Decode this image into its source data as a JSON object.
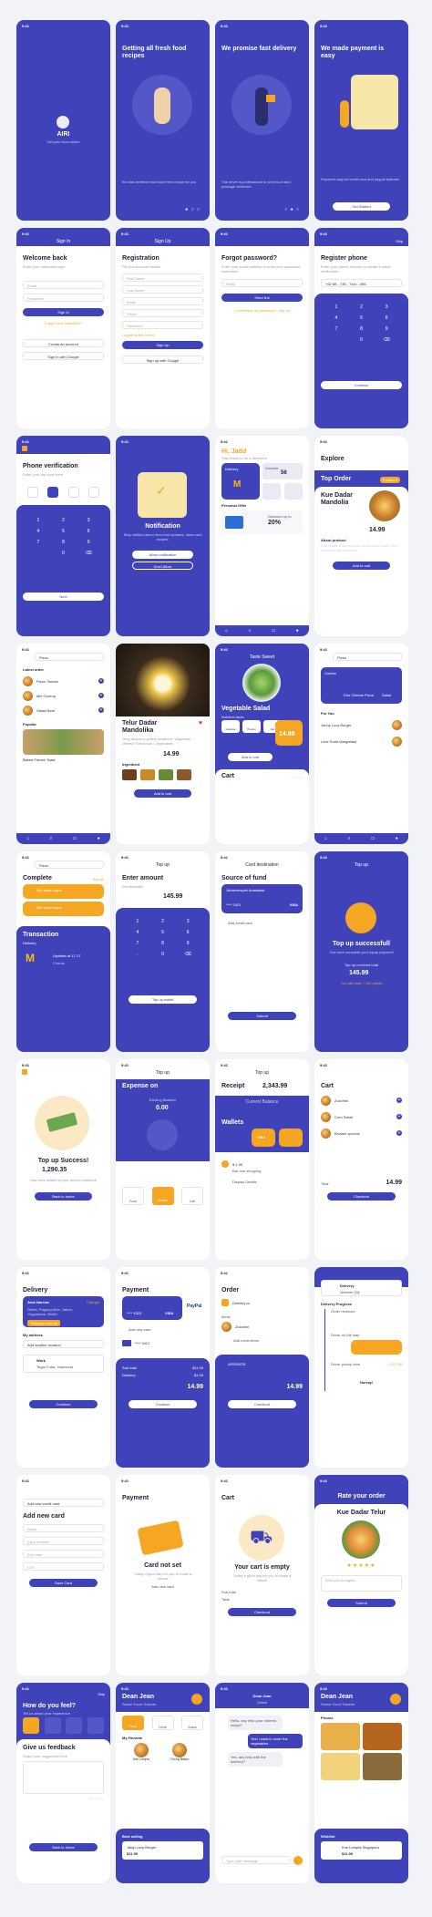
{
  "screens": {
    "splash": {
      "time": "9:41",
      "app_name": "AIRI",
      "tagline": "Get your food online"
    },
    "onboard1": {
      "time": "9:41",
      "title": "Getting all fresh food recipes",
      "desc": "Its total certified read food fresh recipe for you"
    },
    "onboard2": {
      "time": "9:41",
      "title": "We promise fast delivery",
      "desc": "The driver is professional to send food and package delivered"
    },
    "onboard3": {
      "time": "9:41",
      "title": "We made payment is easy",
      "desc": "Payment support credit card and paypal features",
      "button": "Get Started"
    },
    "signin": {
      "time": "9:41",
      "header": "Sign In",
      "title": "Welcome back",
      "sub": "Enter your credential login",
      "email_ph": "Email",
      "password_ph": "Password",
      "button": "Sign In",
      "forgot": "Forgot your password?",
      "or": "Create an account",
      "google": "Sign in with Google"
    },
    "signup": {
      "time": "9:41",
      "header": "Sign Up",
      "title": "Registration",
      "sub": "Fill your account details",
      "first_ph": "First Name",
      "last_name_ph": "Last Name",
      "email_ph": "Email",
      "phone_ph": "Phone",
      "password_ph": "Password",
      "agree": "I agree to the Terms",
      "button": "Sign Up",
      "google": "Sign up with Google"
    },
    "forgot": {
      "time": "9:41",
      "title": "Forgot password?",
      "sub": "Enter your email address to reset your password instruction",
      "email_ph": "Email",
      "button": "Send link",
      "link": "I remember my password? Sign in"
    },
    "register_phone": {
      "time": "9:41",
      "action": "Skip",
      "title": "Register phone",
      "sub": "Enter your phone number to create & setup verification",
      "phone": "+62 88 - 735 - 7xxx - 456",
      "button": "Continue"
    },
    "phone_verify": {
      "time": "9:41",
      "title": "Phone verification",
      "sub": "Enter your otp code here",
      "button": "Next"
    },
    "notification": {
      "time": "9:41",
      "title": "Notification",
      "desc": "Stay notified about new food updates, menu and recipes.",
      "allow": "Allow notification",
      "deny": "Don't Allow"
    },
    "home": {
      "time": "9:41",
      "greeting": "Hi, Jadd",
      "sub": "Stay ready to be a delivered",
      "delivery_label": "Delivery",
      "voucher_label": "Voucher",
      "voucher_count": "56",
      "voucher_unit": "Items",
      "personal_offer": "Personal Offer",
      "discount_label": "Discount up to",
      "discount_value": "20%",
      "badge": "New"
    },
    "explore": {
      "time": "9:41",
      "title": "Explore",
      "section": "Top Order",
      "badge": "Featured",
      "item_name": "Kue Dadar Mandolia",
      "price": "14.99",
      "about": "About product",
      "about_text": "Kue dadar is tell cheerful about food made food delicious and authentic",
      "button": "Add to cart"
    },
    "search_list": {
      "time": "9:41",
      "search_ph": "Pizza",
      "section": "Latest order",
      "items": [
        {
          "name": "Pizza Tomato",
          "price": "$11.99"
        },
        {
          "name": "Mie Goreng",
          "price": "$11.99"
        },
        {
          "name": "Salad Bowl",
          "price": "$11.99"
        }
      ],
      "popular": "Popular",
      "popular_item": "Baked French Toast",
      "popular_price": "$14.99"
    },
    "product_detail": {
      "time": "9:41",
      "name": "Telur Dadar Mandolika",
      "desc": "Omg delicious grilled sandwich. Vegetable, cheese! Scrubcoal / Vegetables",
      "price": "14.99",
      "ingredient": "Ingredient",
      "button": "Add to cart"
    },
    "salad_detail": {
      "time": "9:41",
      "header": "Taste Sweet",
      "name": "Vegetable Salad",
      "nutrition": "Nutrition facts",
      "cal_label": "Calories",
      "protein_label": "Protein",
      "fat_label": "Fat",
      "price": "14.99",
      "button": "Add to cart",
      "cart_title": "Cart",
      "cart_note": "2 items"
    },
    "search_grid": {
      "time": "9:41",
      "search_ph": "Pizza",
      "dish1": "Combo",
      "dish2": "Dim Cheese Pizza",
      "dish3": "Salad",
      "for_you": "For You",
      "item1": "Jenny Lucy Burger",
      "item2": "Lime Soda Margaritas",
      "price": "$11.99",
      "deliver": "Delivery"
    },
    "complete": {
      "time": "9:41",
      "search_ph": "Pizza",
      "title": "Complete",
      "see_all": "See All",
      "item1": "Mie ayam sayur",
      "item1_price": "$15.00",
      "item2": "Mie ayam sayur",
      "item2_price": "$15.00",
      "transaction": "Transaction",
      "tx_status": "Delivery",
      "tx_name": "Updates at 17.17",
      "tx_sub": "2 items"
    },
    "topup": {
      "time": "9:41",
      "header": "Top up",
      "title": "Enter amount",
      "sub": "Set Manually",
      "amount": "145.99",
      "button": "Top up wallet"
    },
    "card_dest": {
      "time": "9:41",
      "header": "Card destination",
      "title": "Source of fund",
      "card_name": "Johannesyah Anastasia",
      "card_number": "**** 3421",
      "card_brand": "VISA",
      "add": "Add credit card",
      "button": "Submit"
    },
    "topup_success": {
      "time": "9:41",
      "header": "Top up",
      "title": "Top up successfull",
      "desc": "You have complete your topup payment",
      "label": "Top up received total",
      "amount": "145.99",
      "points": "You will earn + 100 points"
    },
    "topup_done": {
      "time": "9:41",
      "title": "Top up Success!",
      "amount": "1,290.35",
      "desc": "Has been added to your account balance",
      "button": "Back to home"
    },
    "expense": {
      "time": "9:41",
      "header": "Top up",
      "title": "Expense on",
      "balance_label": "Existing Balance",
      "balance": "0.00",
      "tab1": "Food",
      "tab2": "Drinks",
      "tab3": "Cart"
    },
    "receipt": {
      "time": "9:41",
      "header": "Top up",
      "title": "Receipt",
      "amount": "2,343.99",
      "balance_label": "Current Balance",
      "wallets": "Wallets",
      "wallet_card": "VISA",
      "tx1_amount": "$ 1.99",
      "tx1_label": "Bar one shopping",
      "tx2_label": "Display Details"
    },
    "cart": {
      "time": "9:41",
      "title": "Cart",
      "items": [
        {
          "name": "Zucchini",
          "price": "$11.99"
        },
        {
          "name": "Corn Santo",
          "price": "$11.99"
        },
        {
          "name": "Brussel sprouts",
          "price": "$11.99"
        }
      ],
      "total_label": "Total",
      "total": "14.99",
      "button": "Checkout"
    },
    "delivery": {
      "time": "9:41",
      "title": "Delivery",
      "change": "Change",
      "name": "Jack Narrow",
      "address": "Street, Pagang Atas, Jaban, Yogyakarta, 55461",
      "method": "Shipping method",
      "addresses": "My address",
      "add_location": "Add another location",
      "work": "Work",
      "work_address": "Tegal Coba, Indonesia",
      "button": "Continue"
    },
    "payment": {
      "time": "9:41",
      "title": "Payment",
      "card_num": "**** 4323",
      "card_brand": "VISA",
      "paypal": "PayPal",
      "add": "Add new card",
      "card2": "**** 3421",
      "sub_total": "Sub total",
      "sub_value": "$11.99",
      "delivery_fee": "Delivery",
      "delivery_value": "$1.99",
      "total": "14.99",
      "button": "Continue"
    },
    "order": {
      "time": "9:41",
      "title": "Order",
      "delivery_to": "Delivery to",
      "street": "Jl. Jalan",
      "items": "Items",
      "item1": "Zucchini",
      "item1_price": "$11.99",
      "add": "Add more items",
      "code_label": "APERSOS",
      "total": "14.99",
      "button": "Checkout"
    },
    "tracking": {
      "time": "1:20 PM",
      "delivery": "Delivery",
      "number": "Number Qty",
      "progress": "Delivery Progress",
      "step1": "Order received",
      "step2": "Driver on the way",
      "step3": "Driver pickup time",
      "done": "Hurray!"
    },
    "add_card": {
      "time": "9:41",
      "add": "Add new credit card",
      "title": "Add new card",
      "name_ph": "Name",
      "number_ph": "Card Number",
      "exp_ph": "Exp Date",
      "cvv_ph": "CVV",
      "button": "Save Card"
    },
    "payment_empty": {
      "time": "9:41",
      "title": "Payment",
      "empty_title": "Card not set",
      "empty_desc": "Today a good day for you to make a choice",
      "add": "Add new card"
    },
    "cart_empty": {
      "time": "9:41",
      "title": "Cart",
      "empty_title": "Your cart is empty",
      "empty_desc": "Today a good day for you to make a choice",
      "sub": "Sub total",
      "total_label": "Total",
      "button": "Checkout"
    },
    "rate": {
      "time": "9:41",
      "title": "Rate your order",
      "item": "Kue Dadar Telur",
      "comment_ph": "Add your thoughts...",
      "button": "Submit"
    },
    "feedback": {
      "time": "9:41",
      "action": "Skip",
      "title": "How do you feel?",
      "sub": "Tell us about your experience",
      "feedback_title": "Give us feedback",
      "feedback_sub": "Share your suggestion here",
      "button": "Back to home",
      "count": "200 limits"
    },
    "profile": {
      "time": "9:41",
      "name": "Dean Jean",
      "role": "Senior Food Traveler",
      "favorites": "My Favorite",
      "tab1": "Food",
      "tab2": "Drink",
      "tab3": "Snack",
      "fav1": "Mie Lumpia",
      "fav2": "Cheng Bakso",
      "best": "Best selling",
      "best_item": "Jalop Lucy Burger",
      "best_price": "$11.99"
    },
    "chat": {
      "time": "9:41",
      "name": "Dean Jean",
      "status": "Online",
      "msg1": "Hello, any help your ordered recipe?",
      "msg2": "Yes! i want to order the vegetables",
      "msg3": "Yes, any help with the delivery?",
      "input_ph": "Type your message"
    },
    "profile2": {
      "time": "9:41",
      "name": "Dean Jean",
      "role": "Senior Food Traveler",
      "photos": "Photos",
      "wishlist": "Wishlist",
      "wish_item": "Kue Lumpia Singapura",
      "wish_price": "$11.99"
    }
  },
  "colors": {
    "primary": "#3f42b8",
    "accent": "#f5a623",
    "text": "#1e1f3a"
  }
}
